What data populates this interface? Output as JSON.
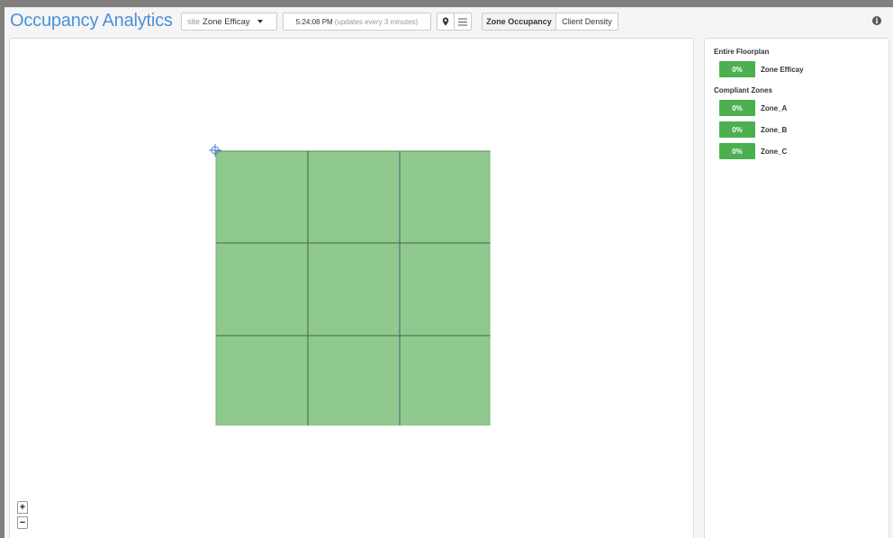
{
  "header": {
    "title": "Occupancy Analytics",
    "site_prefix": "site",
    "site_name": "Zone Efficay",
    "time": "5:24:08 PM",
    "update_note": "(updates every 3 minutes)",
    "tabs": [
      {
        "label": "Zone Occupancy",
        "active": true
      },
      {
        "label": "Client Density",
        "active": false
      }
    ],
    "info_glyph": "i"
  },
  "sidebar": {
    "entire_title": "Entire Floorplan",
    "entire": {
      "value": "0%",
      "name": "Zone Efficay"
    },
    "compliant_title": "Compliant Zones",
    "zones": [
      {
        "value": "0%",
        "name": "Zone_A"
      },
      {
        "value": "0%",
        "name": "Zone_B"
      },
      {
        "value": "0%",
        "name": "Zone_C"
      }
    ]
  },
  "map": {
    "zoom_in": "+",
    "zoom_out": "−",
    "fill_color": "#8fc98d",
    "line_color": "#3f6b3f"
  },
  "colors": {
    "accent": "#4a90d9",
    "badge_green": "#4caf50"
  }
}
